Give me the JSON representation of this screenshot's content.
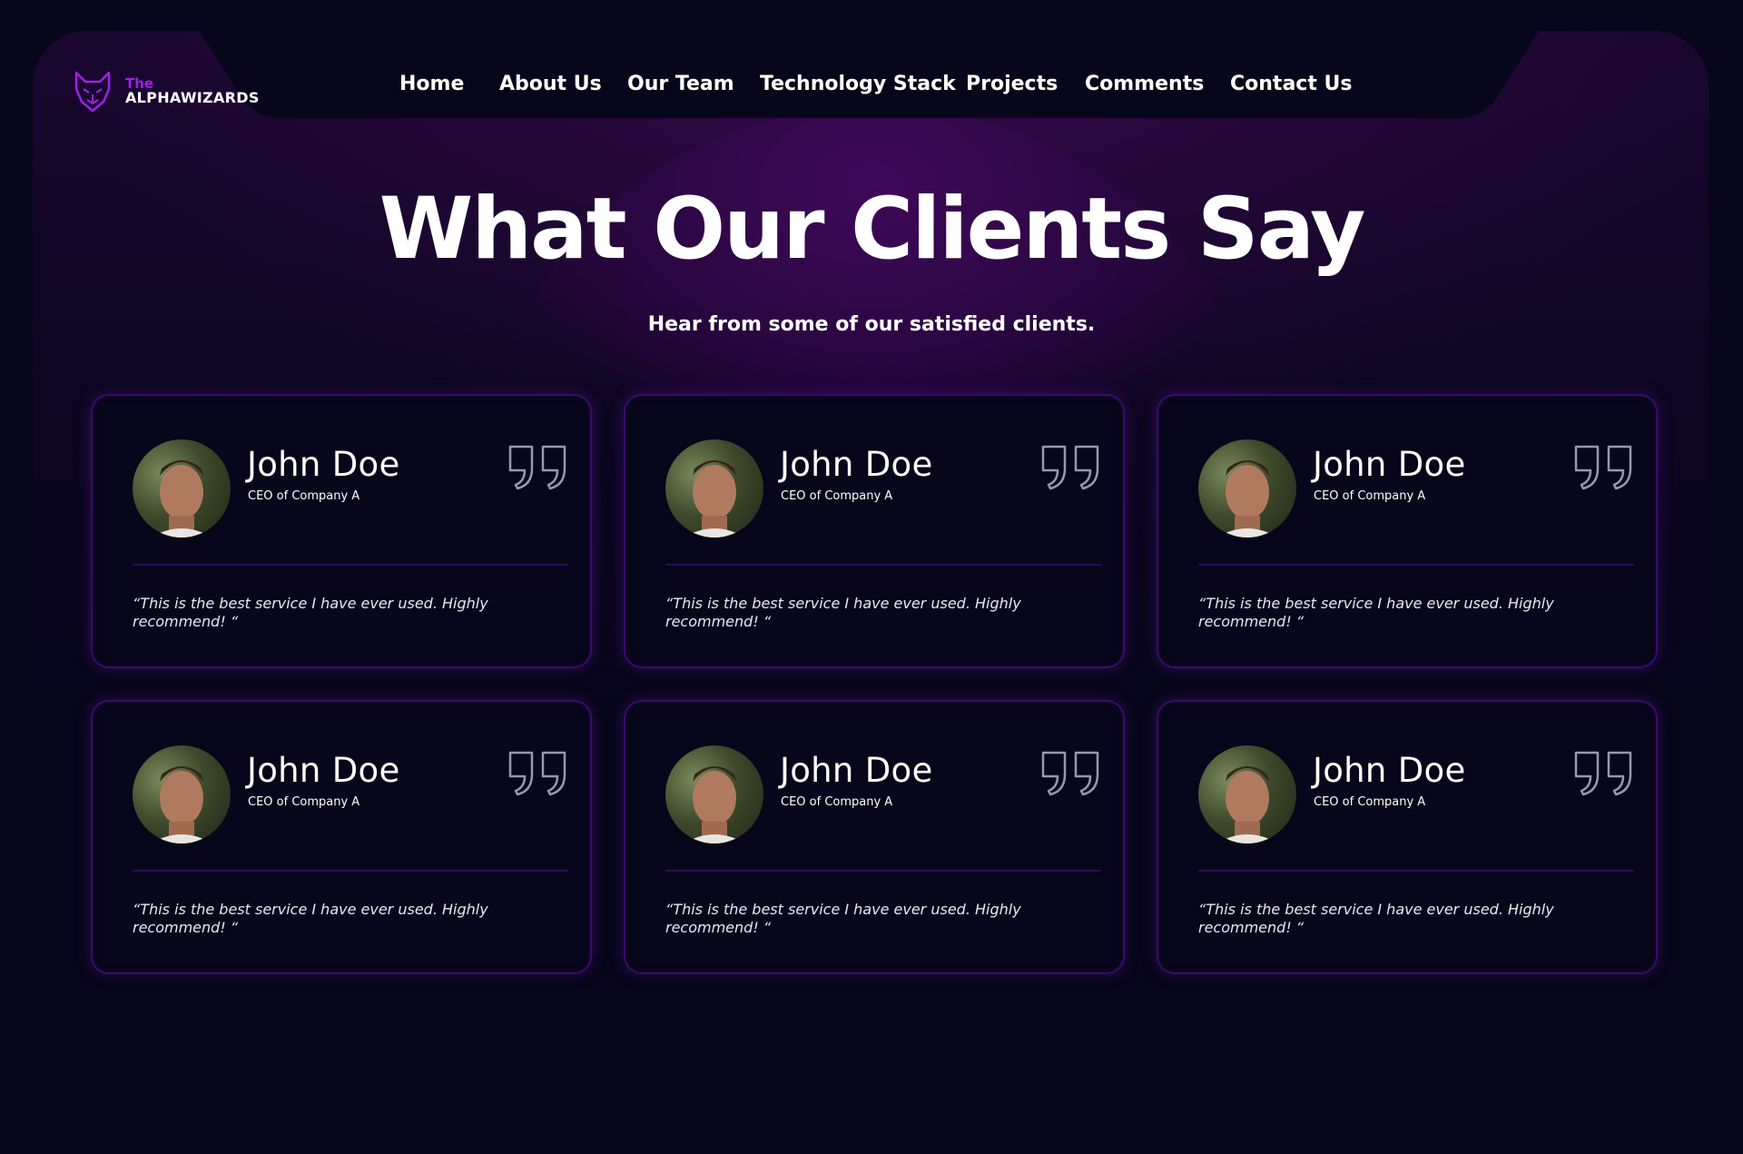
{
  "brand": {
    "line1": "The",
    "line2": "ALPHAWIZARDS",
    "icon": "wolf-logo-icon",
    "accent_color": "#a020e8"
  },
  "nav": {
    "items": [
      {
        "label": "Home"
      },
      {
        "label": "About Us"
      },
      {
        "label": "Our Team"
      },
      {
        "label": "Technology Stack"
      },
      {
        "label": "Projects"
      },
      {
        "label": "Comments"
      },
      {
        "label": "Contact Us"
      }
    ]
  },
  "hero": {
    "title": "What Our Clients Say",
    "subtitle": "Hear from some of our satisfied clients."
  },
  "testimonials": [
    {
      "name": "John Doe",
      "role": "CEO of Company A",
      "quote": "“This is the best service I have ever used. Highly recommend! “",
      "avatar": "portrait-avatar",
      "icon": "quote-icon"
    },
    {
      "name": "John Doe",
      "role": "CEO of Company A",
      "quote": "“This is the best service I have ever used. Highly recommend! “",
      "avatar": "portrait-avatar",
      "icon": "quote-icon"
    },
    {
      "name": "John Doe",
      "role": "CEO of Company A",
      "quote": "“This is the best service I have ever used. Highly recommend! “",
      "avatar": "portrait-avatar",
      "icon": "quote-icon"
    },
    {
      "name": "John Doe",
      "role": "CEO of Company A",
      "quote": "“This is the best service I have ever used. Highly recommend! “",
      "avatar": "portrait-avatar",
      "icon": "quote-icon"
    },
    {
      "name": "John Doe",
      "role": "CEO of Company A",
      "quote": "“This is the best service I have ever used. Highly recommend! “",
      "avatar": "portrait-avatar",
      "icon": "quote-icon"
    },
    {
      "name": "John Doe",
      "role": "CEO of Company A",
      "quote": "“This is the best service I have ever used. Highly recommend! “",
      "avatar": "portrait-avatar",
      "icon": "quote-icon"
    }
  ],
  "colors": {
    "background": "#07061a",
    "card_border": "#3a0b6a",
    "glow": "#40095a"
  }
}
